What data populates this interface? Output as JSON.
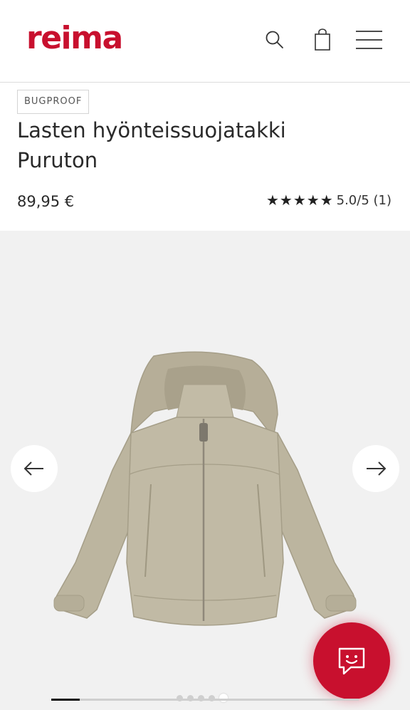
{
  "header": {
    "logo": "reima",
    "icons": [
      "search-icon",
      "shopping-bag-icon",
      "menu-icon"
    ]
  },
  "product": {
    "tag": "BUGPROOF",
    "title_line1": "Lasten hyönteissuojatakki",
    "title_line2": "Puruton",
    "price": "89,95 €",
    "rating": {
      "stars": 5,
      "text": "5.0/5 (1)"
    }
  },
  "gallery": {
    "image": "beige hooded kids jacket",
    "current_slide": 5,
    "total_slides": 5
  },
  "colors": {
    "brand": "#c8102e",
    "jacket": "#bcb59f",
    "gallery_bg": "#f1f1f1"
  }
}
